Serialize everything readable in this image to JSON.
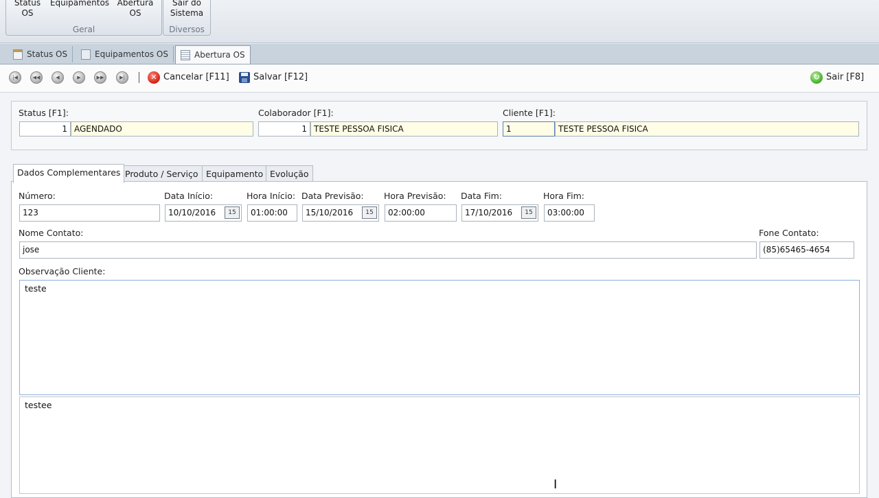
{
  "ribbon": {
    "groups": [
      {
        "caption": "Geral",
        "buttons": [
          "Status\nOS",
          "Equipamentos",
          "Abertura\nOS"
        ]
      },
      {
        "caption": "Diversos",
        "buttons": [
          "Sair do\nSistema"
        ]
      }
    ]
  },
  "doc_tabs": [
    {
      "label": "Status OS"
    },
    {
      "label": "Equipamentos OS"
    },
    {
      "label": "Abertura OS",
      "active": true
    }
  ],
  "toolbar": {
    "nav_buttons": [
      "first-icon",
      "prior-page-icon",
      "prior-icon",
      "next-icon",
      "next-page-icon",
      "last-icon"
    ],
    "separator": "|",
    "cancel_label": "Cancelar [F11]",
    "save_label": "Salvar [F12]",
    "exit_label": "Sair [F8]"
  },
  "header_form": {
    "status": {
      "label": "Status [F1]:",
      "code": "1",
      "name": "AGENDADO"
    },
    "colaborador": {
      "label": "Colaborador [F1]:",
      "code": "1",
      "name": "TESTE PESSOA FISICA"
    },
    "cliente": {
      "label": "Cliente [F1]:",
      "code": "1",
      "name": "TESTE PESSOA FISICA"
    }
  },
  "inner_tabs": [
    {
      "label": "Dados Complementares",
      "active": true
    },
    {
      "label": "Produto / Serviço"
    },
    {
      "label": "Equipamento"
    },
    {
      "label": "Evolução"
    }
  ],
  "dados": {
    "numero": {
      "label": "Número:",
      "value": "123"
    },
    "data_inicio": {
      "label": "Data Início:",
      "value": "10/10/2016"
    },
    "hora_inicio": {
      "label": "Hora Início:",
      "value": "01:00:00"
    },
    "data_previsao": {
      "label": "Data Previsão:",
      "value": "15/10/2016"
    },
    "hora_previsao": {
      "label": "Hora Previsão:",
      "value": "02:00:00"
    },
    "data_fim": {
      "label": "Data Fim:",
      "value": "17/10/2016"
    },
    "hora_fim": {
      "label": "Hora Fim:",
      "value": "03:00:00"
    },
    "nome_contato": {
      "label": "Nome Contato:",
      "value": "jose"
    },
    "fone_contato": {
      "label": "Fone Contato:",
      "value": "(85)65465-4654"
    },
    "observacao_cliente": {
      "label": "Observação Cliente:",
      "value": "teste"
    },
    "observacao_2": {
      "value": "testee"
    }
  },
  "calendar_glyph": "15"
}
